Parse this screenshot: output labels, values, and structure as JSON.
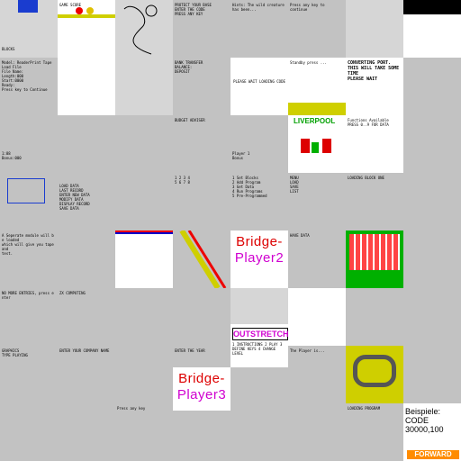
{
  "window": {
    "title": "ZX Spectrum screenshot contact sheet"
  },
  "tiles": {
    "t00": {
      "text": "BLOCKS"
    },
    "t01": {
      "text": "GAME SCORE"
    },
    "t02": {
      "text": ""
    },
    "t03": {
      "text": "PROTECT YOUR BASE\nENTER THE CODE\nPRESS ANY KEY"
    },
    "t04": {
      "text": "Hints: The wild creature\nhas been..."
    },
    "t05": {
      "text": "Press any key to\ncontinue"
    },
    "t06": {
      "text": ""
    },
    "t07": {
      "text": ""
    },
    "t10": {
      "text": "Model: ReaderPrint Tape\nLoad File\nFile Name:\nLength:000\nStart:0000\nReady:\nPress key to Continue"
    },
    "t11": {
      "text": ""
    },
    "t12": {
      "text": ""
    },
    "t13": {
      "text": "BANK TRANSFER\nBALANCE:\nDEPOSIT\n"
    },
    "t14": {
      "text": "PLEASE WAIT LOADING CODE"
    },
    "t15": {
      "text": "Standby press ..."
    },
    "t16": {
      "text": "CONVERTING PORT.\nTHIS WILL TAKE SOME TIME\nPLEASE WAIT"
    },
    "t17": {
      "text": ""
    },
    "t20": {
      "text": "1:88\nBonus:000"
    },
    "t21": {
      "text": ""
    },
    "t22": {
      "text": ""
    },
    "t23": {
      "text": "BUDGET ADVISER"
    },
    "t24": {
      "text": "Player 1\nBonus"
    },
    "t25": {
      "text": "LIVERPOOL"
    },
    "t26": {
      "text": "Functions Available\nPRESS 0..9 FOR DATA"
    },
    "t27": {
      "text": ""
    },
    "t30": {
      "text": ""
    },
    "t31": {
      "text": "LOAD DATA\nLAST RECORD\nENTER NEW DATA\nMODIFY DATA\nDISPLAY RECORD\nSAVE DATA"
    },
    "t32": {
      "text": ""
    },
    "t33": {
      "text": "1 2 3 4\n5 6 7 8"
    },
    "t34": {
      "text": "1 Set Blocks\n2 Add Program\n3 Get Data\n4 Run Programs\n5 Pre-Programmed"
    },
    "t35": {
      "text": "MENU\nLOAD\nSAVE\nLIST"
    },
    "t36": {
      "text": "LOADING BLOCK ONE"
    },
    "t37": {
      "text": ""
    },
    "t40": {
      "text": "A Seperate module will be loaded\nwhich will give you tape and\ntest."
    },
    "t41": {
      "text": ""
    },
    "t42": {
      "text": ""
    },
    "t43": {
      "text": ""
    },
    "t44": {
      "bridge": [
        "Bridge-",
        "Player2"
      ]
    },
    "t45": {
      "text": "HAVE DATA"
    },
    "t46": {
      "text": ""
    },
    "t47": {
      "text": ""
    },
    "t50": {
      "text": "NO MORE ENTRIES, press enter"
    },
    "t51": {
      "text": "ZX COMPUTING"
    },
    "t52": {
      "text": ""
    },
    "t53": {
      "text": ""
    },
    "t54": {
      "text": ""
    },
    "t55": {
      "text": ""
    },
    "t56": {
      "text": ""
    },
    "t57": {
      "text": ""
    },
    "t60": {
      "text": "GRAPHICS\nTYPE PLAYING"
    },
    "t61": {
      "text": "ENTER YOUR COMPANY NAME"
    },
    "t62": {
      "text": ""
    },
    "t63": {
      "text": "ENTER THE YEAR"
    },
    "t64": {
      "text": ""
    },
    "t65": {
      "text": "The Player is..."
    },
    "t66": {
      "text": ""
    },
    "t67": {
      "text": ""
    },
    "t70": {
      "text": ""
    },
    "t71": {
      "text": ""
    },
    "t72": {
      "text": "Press any key"
    },
    "t73": {
      "text": ""
    },
    "t74": {
      "text": ""
    },
    "t75": {
      "text": ""
    },
    "t76": {
      "text": "LOADING PROGRAM"
    },
    "t77": {
      "text": "INSERT CASSETTE"
    },
    "t80": {
      "text": ""
    },
    "t81": {
      "text": "ALL DATA ERASED FROM BANK\nPLEASE WAIT WHILE I SET UP"
    },
    "t82": {
      "text": "Best 1 Hol\nSUPER PROGRAM"
    },
    "t83": {
      "text": ""
    },
    "t84": {
      "banner": "OUTSTRETCH",
      "text": "1 INSTRUCTIONS\n2 PLAY\n3 DEFINE KEYS\n4 CHANGE LEVEL"
    },
    "t85": {
      "text": ""
    },
    "t86": {
      "text": ""
    },
    "t87": {
      "text": ""
    },
    "t90": {
      "text": ""
    },
    "t91": {
      "text": "1 PRESS 1 TO CONTINUE\n2 NOTE\n3 SAVE\n4 RESET"
    },
    "t92": {
      "bridge": [
        "Bridge-",
        "Player3"
      ]
    },
    "t93": {
      "text": ""
    },
    "t94": {
      "text": ""
    },
    "t95": {
      "text": ""
    },
    "t96": {
      "text": ""
    },
    "t97": {
      "text": "Beispiele:\nCODE 30000,100"
    },
    "t98": {
      "fwd": "FORWARD"
    }
  }
}
